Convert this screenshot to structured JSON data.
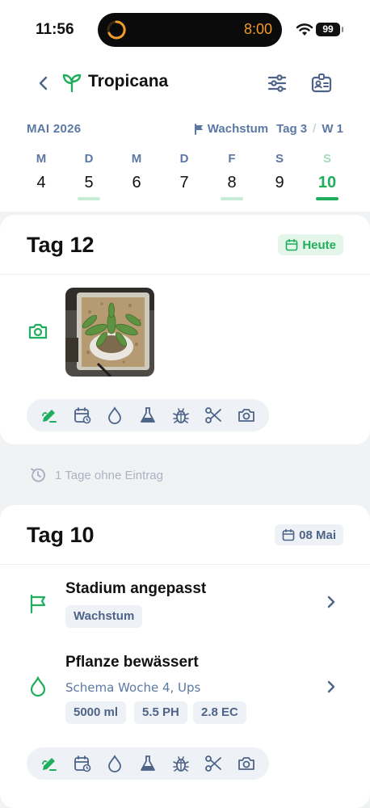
{
  "status_bar": {
    "time": "11:56",
    "timer": "8:00",
    "battery": "99"
  },
  "header": {
    "title": "Tropicana"
  },
  "calendar": {
    "month": "MAI 2026",
    "phase": "Wachstum",
    "day_label": "Tag 3",
    "separator": "/",
    "week_label": "W 1",
    "days": [
      {
        "wd": "M",
        "n": "4"
      },
      {
        "wd": "D",
        "n": "5"
      },
      {
        "wd": "M",
        "n": "6"
      },
      {
        "wd": "D",
        "n": "7"
      },
      {
        "wd": "F",
        "n": "8"
      },
      {
        "wd": "S",
        "n": "9"
      },
      {
        "wd": "S",
        "n": "10"
      }
    ]
  },
  "card1": {
    "title": "Tag 12",
    "badge": "Heute"
  },
  "gap_note": "1 Tage ohne Eintrag",
  "card2": {
    "title": "Tag 10",
    "badge": "08 Mai",
    "entries": [
      {
        "title": "Stadium angepasst",
        "chips": [
          "Wachstum"
        ]
      },
      {
        "title": "Pflanze bewässert",
        "subtitle": "Schema Woche 4, Ups",
        "chips": [
          "5000 ml",
          "5.5 PH",
          "2.8 EC"
        ]
      }
    ]
  },
  "colors": {
    "accent": "#1fae5b",
    "muted": "#5b78a4",
    "timer": "#f39a2b"
  },
  "toolbar_icons": [
    "note-icon",
    "calendar-repeat-icon",
    "water-drop-icon",
    "flask-icon",
    "bug-icon",
    "scissors-icon",
    "camera-icon"
  ]
}
